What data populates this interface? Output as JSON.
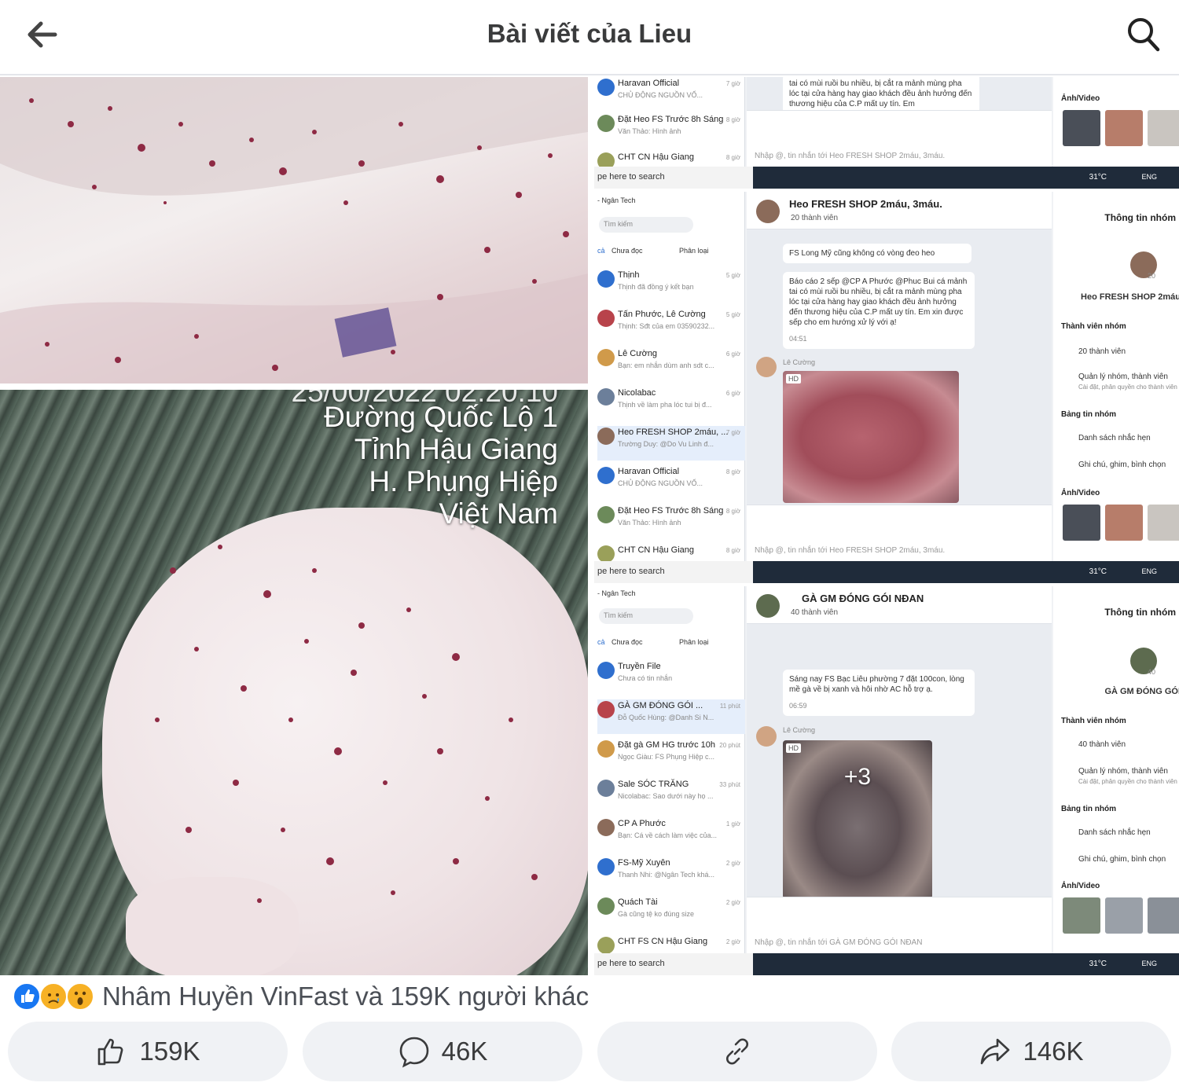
{
  "header": {
    "title": "Bài viết của Lieu",
    "back_icon": "arrow-left-icon",
    "search_icon": "search-icon"
  },
  "photos": {
    "bottom_overlay_clipped": "25/00/2022 02:20:10",
    "bottom_overlay_lines": [
      "Đường Quốc Lộ 1",
      "Tỉnh Hậu Giang",
      "H. Phụng Hiệp",
      "Việt Nam"
    ]
  },
  "screenshot_1": {
    "conversations": [
      {
        "name": "Haravan Official",
        "snippet": "CHỦ ĐỘNG NGUỒN VỐ...",
        "time": "7 giờ"
      },
      {
        "name": "Đặt Heo FS Trước 8h Sáng",
        "snippet": "Văn Thảo: Hình ảnh",
        "time": "8 giờ"
      },
      {
        "name": "CHT CN Hậu Giang",
        "snippet": "",
        "time": "8 giờ"
      }
    ],
    "message": "tai có mùi ruồi bu nhiều, bị cắt ra mảnh mùng pha lóc tại cửa hàng hay giao khách đều ảnh hưởng đến thương hiệu của C.P mất uy tín. Em",
    "input_placeholder": "Nhập @, tin nhắn tới Heo FRESH SHOP 2máu, 3máu.",
    "info_media_label": "Ảnh/Video",
    "taskbar_search": "pe here to search",
    "taskbar_temp": "31°C",
    "taskbar_lang": "ENG"
  },
  "screenshot_2": {
    "window_title": "- Ngân Tech",
    "search_placeholder": "Tìm kiếm",
    "filter_tabs": [
      "cả",
      "Chưa đọc",
      "Phân loại"
    ],
    "conversations": [
      {
        "name": "Thịnh",
        "snippet": "Thịnh đã đồng ý kết bạn",
        "time": "5 giờ"
      },
      {
        "name": "Tấn Phước, Lê Cường",
        "snippet": "Thịnh: Sđt của em 03590232...",
        "time": "5 giờ"
      },
      {
        "name": "Lê Cường",
        "snippet": "Bạn: em nhắn dùm anh sdt c...",
        "time": "6 giờ"
      },
      {
        "name": "Nicolabac",
        "snippet": "Thịnh về làm pha lóc tui bị đ...",
        "time": "6 giờ"
      },
      {
        "name": "Heo FRESH SHOP 2máu, ...",
        "snippet": "Trường Duy: @Do Vu Linh đ...",
        "time": "7 giờ"
      },
      {
        "name": "Haravan Official",
        "snippet": "CHỦ ĐỘNG NGUỒN VỐ...",
        "time": "8 giờ"
      },
      {
        "name": "Đặt Heo FS Trước 8h Sáng",
        "snippet": "Văn Thảo: Hình ảnh",
        "time": "8 giờ"
      },
      {
        "name": "CHT CN Hậu Giang",
        "snippet": "",
        "time": "8 giờ"
      }
    ],
    "chat_name": "Heo FRESH SHOP 2máu, 3máu.",
    "chat_members": "20 thành viên",
    "msg_1": "FS Long Mỹ cũng không có vòng đeo heo",
    "msg_2": "Báo cáo 2 sếp @CP A Phước @Phuc Bui cá mảnh tai có mùi ruồi bu nhiều, bị cắt ra mảnh mùng pha lóc tại cửa hàng hay giao khách đều ảnh hưởng đến thương hiệu của C.P mất uy tín. Em xin được sếp cho em hướng xử lý với ạ!",
    "msg_2_time": "04:51",
    "sender": "Lê Cường",
    "hd_badge": "HD",
    "input_placeholder": "Nhập @, tin nhắn tới Heo FRESH SHOP 2máu, 3máu.",
    "info_title": "Thông tin nhóm",
    "info_group_name": "Heo FRESH SHOP 2máu",
    "info_members_head": "Thành viên nhóm",
    "info_members": "20 thành viên",
    "info_manage": "Quản lý nhóm, thành viên",
    "info_manage_sub": "Cài đặt, phân quyền cho thành viên",
    "info_board_head": "Bảng tin nhóm",
    "info_reminders": "Danh sách nhắc hẹn",
    "info_notes": "Ghi chú, ghim, bình chọn",
    "info_media_label": "Ảnh/Video",
    "avatar_count": "20",
    "taskbar_search": "pe here to search",
    "taskbar_temp": "31°C",
    "taskbar_lang": "ENG"
  },
  "screenshot_3": {
    "window_title": "- Ngân Tech",
    "search_placeholder": "Tìm kiếm",
    "filter_tabs": [
      "cả",
      "Chưa đọc",
      "Phân loại"
    ],
    "conversations": [
      {
        "name": "Truyền File",
        "snippet": "Chưa có tin nhắn",
        "time": ""
      },
      {
        "name": "GÀ GM ĐÓNG GÓI ...",
        "snippet": "Đỗ Quốc Hùng: @Danh Si N...",
        "time": "11 phút"
      },
      {
        "name": "Đặt gà GM HG trước 10h",
        "snippet": "Ngọc Giàu: FS Phụng Hiệp c...",
        "time": "20 phút"
      },
      {
        "name": "Sale SÓC TRĂNG",
        "snippet": "Nicolabac: Sao dưới này họ ...",
        "time": "33 phút"
      },
      {
        "name": "CP A Phước",
        "snippet": "Bạn: Cá về cách làm việc của...",
        "time": "1 giờ"
      },
      {
        "name": "FS-Mỹ Xuyên",
        "snippet": "Thanh Nhi: @Ngân Tech khá...",
        "time": "2 giờ"
      },
      {
        "name": "Quách Tài",
        "snippet": "Gà cũng tệ ko đúng size",
        "time": "2 giờ"
      },
      {
        "name": "CHT FS CN Hậu Giang",
        "snippet": "",
        "time": "2 giờ"
      }
    ],
    "chat_name": "GÀ GM ĐÓNG GÓI NĐAN",
    "chat_members": "40 thành viên",
    "msg_1": "Sáng nay FS Bạc Liêu phường 7 đặt 100con, lòng mề gà về bị xanh và hôi nhờ AC hỗ trợ ạ.",
    "msg_1_time": "06:59",
    "sender": "Lê Cường",
    "hd_badge": "HD",
    "more_count": "+3",
    "input_placeholder": "Nhập @, tin nhắn tới GÀ GM ĐÓNG GÓI NĐAN",
    "info_title": "Thông tin nhóm",
    "info_group_name": "GÀ GM ĐÓNG GÓI",
    "info_members_head": "Thành viên nhóm",
    "info_members": "40 thành viên",
    "info_manage": "Quản lý nhóm, thành viên",
    "info_manage_sub": "Cài đặt, phân quyền cho thành viên",
    "info_board_head": "Bảng tin nhóm",
    "info_reminders": "Danh sách nhắc hẹn",
    "info_notes": "Ghi chú, ghim, bình chọn",
    "info_media_label": "Ảnh/Video",
    "avatar_count": "40",
    "taskbar_search": "pe here to search",
    "taskbar_temp": "31°C",
    "taskbar_lang": "ENG"
  },
  "reactions": {
    "icons": [
      "like-reaction-icon",
      "sad-reaction-icon",
      "wow-reaction-icon"
    ],
    "text": "Nhâm Huyền VinFast và 159K người khác"
  },
  "actions": {
    "like_count": "159K",
    "comment_count": "46K",
    "share_count": "146K"
  },
  "colors": {
    "like_blue": "#1877f2",
    "button_bg": "#f0f2f5",
    "title_text": "#3a3b3c"
  }
}
